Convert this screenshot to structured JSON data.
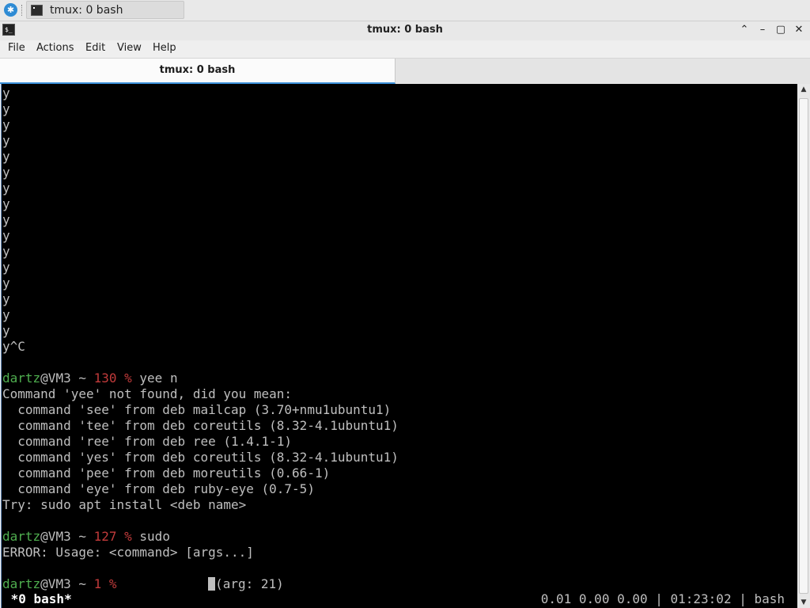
{
  "taskbar": {
    "start_icon": "start-menu-icon",
    "task_label": "tmux: 0 bash"
  },
  "window": {
    "title": "tmux: 0 bash",
    "icon": "terminal-icon",
    "icon_glyph": "$_",
    "controls": {
      "maximize_glyph": "⌃",
      "minimize_glyph": "–",
      "restore_glyph": "▢",
      "close_glyph": "✕"
    }
  },
  "menubar": {
    "file": "File",
    "actions": "Actions",
    "edit": "Edit",
    "view": "View",
    "help": "Help"
  },
  "tab": {
    "label": "tmux: 0 bash"
  },
  "terminal": {
    "y_line": "y",
    "y_ctrl_c": "y^C",
    "prompt_user": "dartz",
    "prompt_host": "@VM3 ~ ",
    "prompt1_code": "130 %",
    "prompt1_cmd": " yee n",
    "not_found": "Command 'yee' not found, did you mean:",
    "suggestions": [
      "  command 'see' from deb mailcap (3.70+nmu1ubuntu1)",
      "  command 'tee' from deb coreutils (8.32-4.1ubuntu1)",
      "  command 'ree' from deb ree (1.4.1-1)",
      "  command 'yes' from deb coreutils (8.32-4.1ubuntu1)",
      "  command 'pee' from deb moreutils (0.66-1)",
      "  command 'eye' from deb ruby-eye (0.7-5)"
    ],
    "try_line": "Try: sudo apt install <deb name>",
    "prompt2_code": "127 %",
    "prompt2_cmd": " sudo",
    "error_line": "ERROR: Usage: <command> [args...]",
    "prompt3_code": "1 %",
    "prompt3_gap": "            ",
    "arg_text": "(arg: 21)",
    "status_left": " *0 bash*",
    "status_right": "0.01 0.00 0.00 | 01:23:02 | bash"
  },
  "scrollbar": {
    "up_glyph": "▲",
    "down_glyph": "▼"
  }
}
